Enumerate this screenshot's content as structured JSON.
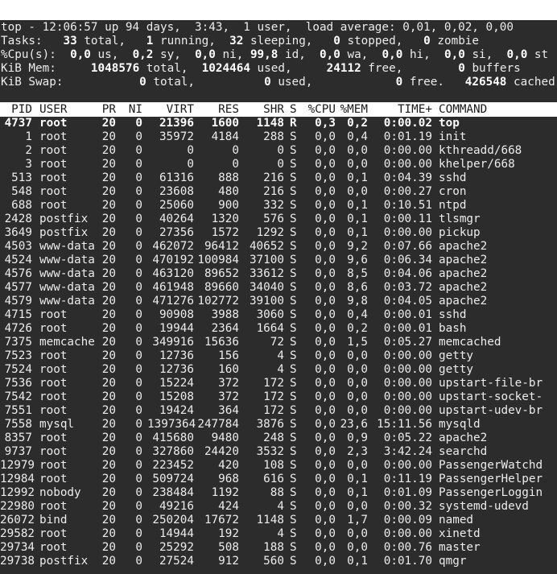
{
  "summary": {
    "line1": "top - 12:06:57 up 94 days,  3:43,  1 user,  load average: 0,01, 0,02, 0,00",
    "tasks": {
      "label": "Tasks:",
      "total": "33",
      "total_label": "total,",
      "running": "1",
      "running_label": "running,",
      "sleeping": "32",
      "sleeping_label": "sleeping,",
      "stopped": "0",
      "stopped_label": "stopped,",
      "zombie": "0",
      "zombie_label": "zombie"
    },
    "cpu": {
      "label": "%Cpu(s):",
      "us": "0,0",
      "us_label": "us,",
      "sy": "0,2",
      "sy_label": "sy,",
      "ni": "0,0",
      "ni_label": "ni,",
      "id": "99,8",
      "id_label": "id,",
      "wa": "0,0",
      "wa_label": "wa,",
      "hi": "0,0",
      "hi_label": "hi,",
      "si": "0,0",
      "si_label": "si,",
      "st": "0,0",
      "st_label": "st"
    },
    "mem": {
      "label": "KiB Mem:",
      "total": "1048576",
      "total_label": "total,",
      "used": "1024464",
      "used_label": "used,",
      "free": "24112",
      "free_label": "free,",
      "buffers": "0",
      "buffers_label": "buffers"
    },
    "swap": {
      "label": "KiB Swap:",
      "total": "0",
      "total_label": "total,",
      "used": "0",
      "used_label": "used,",
      "free": "0",
      "free_label": "free.",
      "cached": "426548",
      "cached_label": "cached Mem"
    }
  },
  "columns": {
    "pid": "PID",
    "user": "USER",
    "pr": "PR",
    "ni": "NI",
    "virt": "VIRT",
    "res": "RES",
    "shr": "SHR",
    "s": "S",
    "cpu": "%CPU",
    "mem": "%MEM",
    "time": "TIME+",
    "command": "COMMAND"
  },
  "processes": [
    {
      "pid": "4737",
      "user": "root",
      "pr": "20",
      "ni": "0",
      "virt": "21396",
      "res": "1600",
      "shr": "1148",
      "s": "R",
      "cpu": "0,3",
      "mem": "0,2",
      "time": "0:00.02",
      "command": "top"
    },
    {
      "pid": "1",
      "user": "root",
      "pr": "20",
      "ni": "0",
      "virt": "35972",
      "res": "4184",
      "shr": "288",
      "s": "S",
      "cpu": "0,0",
      "mem": "0,4",
      "time": "0:01.19",
      "command": "init"
    },
    {
      "pid": "2",
      "user": "root",
      "pr": "20",
      "ni": "0",
      "virt": "0",
      "res": "0",
      "shr": "0",
      "s": "S",
      "cpu": "0,0",
      "mem": "0,0",
      "time": "0:00.00",
      "command": "kthreadd/668"
    },
    {
      "pid": "3",
      "user": "root",
      "pr": "20",
      "ni": "0",
      "virt": "0",
      "res": "0",
      "shr": "0",
      "s": "S",
      "cpu": "0,0",
      "mem": "0,0",
      "time": "0:00.00",
      "command": "khelper/668"
    },
    {
      "pid": "513",
      "user": "root",
      "pr": "20",
      "ni": "0",
      "virt": "61316",
      "res": "888",
      "shr": "216",
      "s": "S",
      "cpu": "0,0",
      "mem": "0,1",
      "time": "0:04.39",
      "command": "sshd"
    },
    {
      "pid": "548",
      "user": "root",
      "pr": "20",
      "ni": "0",
      "virt": "23608",
      "res": "480",
      "shr": "216",
      "s": "S",
      "cpu": "0,0",
      "mem": "0,0",
      "time": "0:00.27",
      "command": "cron"
    },
    {
      "pid": "688",
      "user": "root",
      "pr": "20",
      "ni": "0",
      "virt": "25060",
      "res": "900",
      "shr": "332",
      "s": "S",
      "cpu": "0,0",
      "mem": "0,1",
      "time": "0:10.51",
      "command": "ntpd"
    },
    {
      "pid": "2428",
      "user": "postfix",
      "pr": "20",
      "ni": "0",
      "virt": "40264",
      "res": "1320",
      "shr": "576",
      "s": "S",
      "cpu": "0,0",
      "mem": "0,1",
      "time": "0:00.11",
      "command": "tlsmgr"
    },
    {
      "pid": "3649",
      "user": "postfix",
      "pr": "20",
      "ni": "0",
      "virt": "27356",
      "res": "1572",
      "shr": "1292",
      "s": "S",
      "cpu": "0,0",
      "mem": "0,1",
      "time": "0:00.00",
      "command": "pickup"
    },
    {
      "pid": "4503",
      "user": "www-data",
      "pr": "20",
      "ni": "0",
      "virt": "462072",
      "res": "96412",
      "shr": "40652",
      "s": "S",
      "cpu": "0,0",
      "mem": "9,2",
      "time": "0:07.66",
      "command": "apache2"
    },
    {
      "pid": "4524",
      "user": "www-data",
      "pr": "20",
      "ni": "0",
      "virt": "470192",
      "res": "100984",
      "shr": "37100",
      "s": "S",
      "cpu": "0,0",
      "mem": "9,6",
      "time": "0:06.34",
      "command": "apache2"
    },
    {
      "pid": "4576",
      "user": "www-data",
      "pr": "20",
      "ni": "0",
      "virt": "463120",
      "res": "89652",
      "shr": "33612",
      "s": "S",
      "cpu": "0,0",
      "mem": "8,5",
      "time": "0:04.06",
      "command": "apache2"
    },
    {
      "pid": "4577",
      "user": "www-data",
      "pr": "20",
      "ni": "0",
      "virt": "461948",
      "res": "89660",
      "shr": "34040",
      "s": "S",
      "cpu": "0,0",
      "mem": "8,6",
      "time": "0:03.72",
      "command": "apache2"
    },
    {
      "pid": "4579",
      "user": "www-data",
      "pr": "20",
      "ni": "0",
      "virt": "471276",
      "res": "102772",
      "shr": "39100",
      "s": "S",
      "cpu": "0,0",
      "mem": "9,8",
      "time": "0:04.05",
      "command": "apache2"
    },
    {
      "pid": "4715",
      "user": "root",
      "pr": "20",
      "ni": "0",
      "virt": "90908",
      "res": "3988",
      "shr": "3060",
      "s": "S",
      "cpu": "0,0",
      "mem": "0,4",
      "time": "0:00.01",
      "command": "sshd"
    },
    {
      "pid": "4726",
      "user": "root",
      "pr": "20",
      "ni": "0",
      "virt": "19944",
      "res": "2364",
      "shr": "1664",
      "s": "S",
      "cpu": "0,0",
      "mem": "0,2",
      "time": "0:00.01",
      "command": "bash"
    },
    {
      "pid": "7375",
      "user": "memcache",
      "pr": "20",
      "ni": "0",
      "virt": "349916",
      "res": "15636",
      "shr": "72",
      "s": "S",
      "cpu": "0,0",
      "mem": "1,5",
      "time": "0:05.27",
      "command": "memcached"
    },
    {
      "pid": "7523",
      "user": "root",
      "pr": "20",
      "ni": "0",
      "virt": "12736",
      "res": "156",
      "shr": "4",
      "s": "S",
      "cpu": "0,0",
      "mem": "0,0",
      "time": "0:00.00",
      "command": "getty"
    },
    {
      "pid": "7524",
      "user": "root",
      "pr": "20",
      "ni": "0",
      "virt": "12736",
      "res": "160",
      "shr": "4",
      "s": "S",
      "cpu": "0,0",
      "mem": "0,0",
      "time": "0:00.00",
      "command": "getty"
    },
    {
      "pid": "7536",
      "user": "root",
      "pr": "20",
      "ni": "0",
      "virt": "15224",
      "res": "372",
      "shr": "172",
      "s": "S",
      "cpu": "0,0",
      "mem": "0,0",
      "time": "0:00.00",
      "command": "upstart-file-br"
    },
    {
      "pid": "7542",
      "user": "root",
      "pr": "20",
      "ni": "0",
      "virt": "15208",
      "res": "372",
      "shr": "172",
      "s": "S",
      "cpu": "0,0",
      "mem": "0,0",
      "time": "0:00.00",
      "command": "upstart-socket-"
    },
    {
      "pid": "7551",
      "user": "root",
      "pr": "20",
      "ni": "0",
      "virt": "19424",
      "res": "364",
      "shr": "172",
      "s": "S",
      "cpu": "0,0",
      "mem": "0,0",
      "time": "0:00.00",
      "command": "upstart-udev-br"
    },
    {
      "pid": "7558",
      "user": "mysql",
      "pr": "20",
      "ni": "0",
      "virt": "1397364",
      "res": "247784",
      "shr": "3876",
      "s": "S",
      "cpu": "0,0",
      "mem": "23,6",
      "time": "15:11.56",
      "command": "mysqld"
    },
    {
      "pid": "8357",
      "user": "root",
      "pr": "20",
      "ni": "0",
      "virt": "415680",
      "res": "9480",
      "shr": "248",
      "s": "S",
      "cpu": "0,0",
      "mem": "0,9",
      "time": "0:05.22",
      "command": "apache2"
    },
    {
      "pid": "9737",
      "user": "root",
      "pr": "20",
      "ni": "0",
      "virt": "327860",
      "res": "24420",
      "shr": "3532",
      "s": "S",
      "cpu": "0,0",
      "mem": "2,3",
      "time": "3:42.24",
      "command": "searchd"
    },
    {
      "pid": "12979",
      "user": "root",
      "pr": "20",
      "ni": "0",
      "virt": "223452",
      "res": "420",
      "shr": "108",
      "s": "S",
      "cpu": "0,0",
      "mem": "0,0",
      "time": "0:00.00",
      "command": "PassengerWatchd"
    },
    {
      "pid": "12984",
      "user": "root",
      "pr": "20",
      "ni": "0",
      "virt": "509724",
      "res": "968",
      "shr": "616",
      "s": "S",
      "cpu": "0,0",
      "mem": "0,1",
      "time": "0:11.19",
      "command": "PassengerHelper"
    },
    {
      "pid": "12992",
      "user": "nobody",
      "pr": "20",
      "ni": "0",
      "virt": "238484",
      "res": "1192",
      "shr": "88",
      "s": "S",
      "cpu": "0,0",
      "mem": "0,1",
      "time": "0:01.09",
      "command": "PassengerLoggin"
    },
    {
      "pid": "22980",
      "user": "root",
      "pr": "20",
      "ni": "0",
      "virt": "49216",
      "res": "424",
      "shr": "4",
      "s": "S",
      "cpu": "0,0",
      "mem": "0,0",
      "time": "0:00.32",
      "command": "systemd-udevd"
    },
    {
      "pid": "26072",
      "user": "bind",
      "pr": "20",
      "ni": "0",
      "virt": "250204",
      "res": "17672",
      "shr": "1148",
      "s": "S",
      "cpu": "0,0",
      "mem": "1,7",
      "time": "0:00.09",
      "command": "named"
    },
    {
      "pid": "29582",
      "user": "root",
      "pr": "20",
      "ni": "0",
      "virt": "14944",
      "res": "192",
      "shr": "4",
      "s": "S",
      "cpu": "0,0",
      "mem": "0,0",
      "time": "0:00.00",
      "command": "xinetd"
    },
    {
      "pid": "29734",
      "user": "root",
      "pr": "20",
      "ni": "0",
      "virt": "25292",
      "res": "508",
      "shr": "188",
      "s": "S",
      "cpu": "0,0",
      "mem": "0,0",
      "time": "0:00.76",
      "command": "master"
    },
    {
      "pid": "29738",
      "user": "postfix",
      "pr": "20",
      "ni": "0",
      "virt": "27524",
      "res": "912",
      "shr": "560",
      "s": "S",
      "cpu": "0,0",
      "mem": "0,1",
      "time": "0:01.70",
      "command": "qmgr"
    }
  ],
  "highlighted_row": 0,
  "colors": {
    "terminal_bg": "#2c2c2c",
    "text": "#ececec",
    "header_bg": "#ffffff",
    "header_text": "#1a1a1a"
  }
}
